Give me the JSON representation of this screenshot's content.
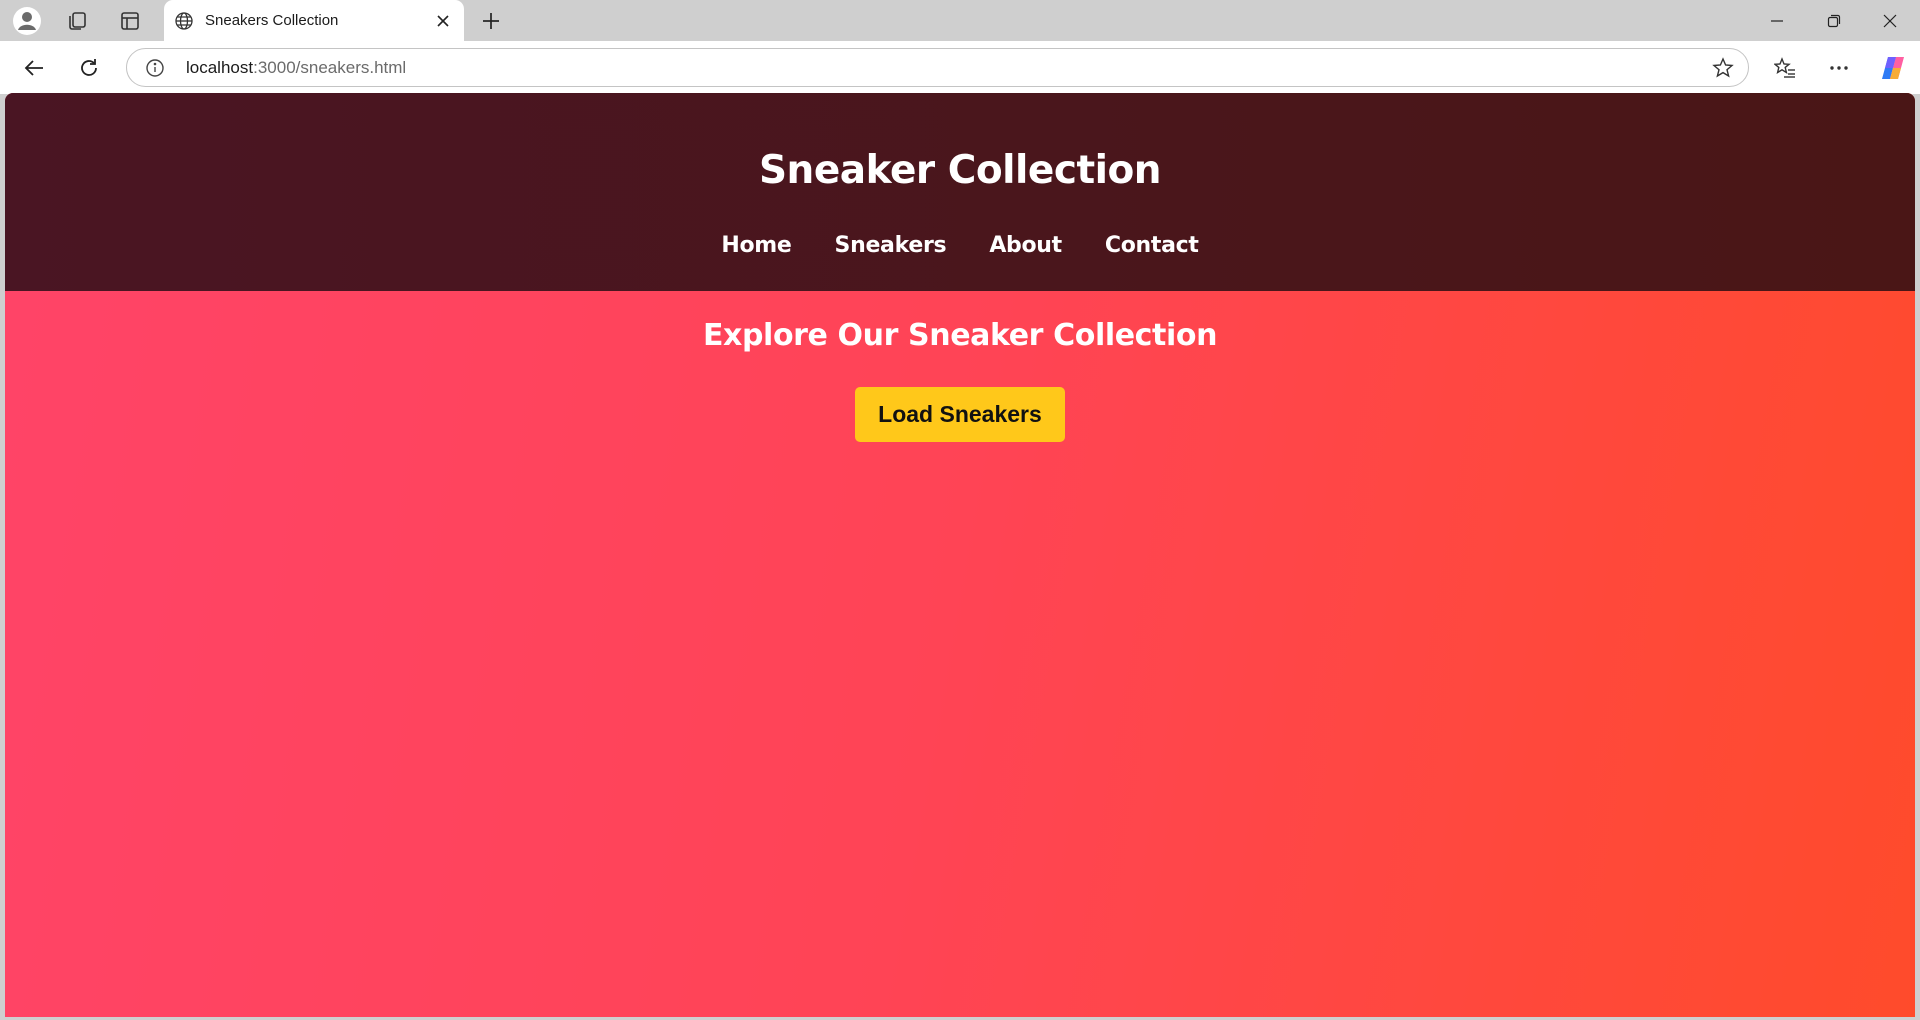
{
  "browser": {
    "tab": {
      "title": "Sneakers Collection"
    },
    "address_bar": {
      "host": "localhost",
      "rest": ":3000/sneakers.html"
    }
  },
  "page": {
    "header": {
      "title": "Sneaker Collection",
      "nav": [
        "Home",
        "Sneakers",
        "About",
        "Contact"
      ]
    },
    "main": {
      "section_title": "Explore Our Sneaker Collection",
      "load_button_label": "Load Sneakers"
    }
  },
  "colors": {
    "header_bg": "#4a1520",
    "page_gradient_start": "#ff4468",
    "page_gradient_end": "#ff4b2b",
    "button_bg": "#ffc81a",
    "text": "#ffffff"
  }
}
